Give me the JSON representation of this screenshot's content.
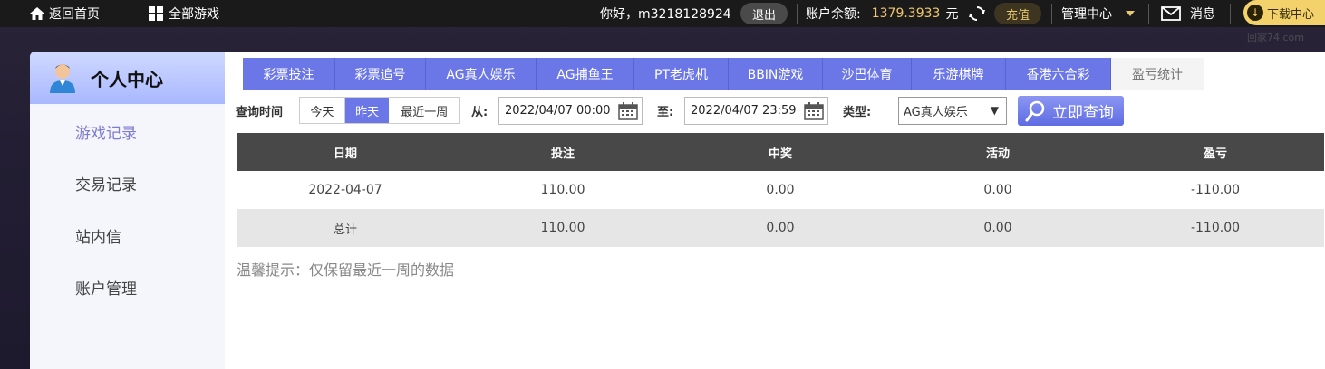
{
  "topbar": {
    "home_label": "返回首页",
    "all_games_label": "全部游戏",
    "greeting": "你好，m3218128924",
    "logout_label": "退出",
    "balance_label": "账户余额:",
    "balance_value": "1379.3933",
    "balance_unit": "元",
    "recharge_label": "充值",
    "admin_label": "管理中心",
    "messages_label": "消息",
    "download_label": "下载中心",
    "watermark": "回家74.com"
  },
  "sidebar": {
    "title": "个人中心",
    "items": [
      {
        "label": "游戏记录"
      },
      {
        "label": "交易记录"
      },
      {
        "label": "站内信"
      },
      {
        "label": "账户管理"
      }
    ]
  },
  "tabs": [
    {
      "label": "彩票投注"
    },
    {
      "label": "彩票追号"
    },
    {
      "label": "AG真人娱乐"
    },
    {
      "label": "AG捕鱼王"
    },
    {
      "label": "PT老虎机"
    },
    {
      "label": "BBIN游戏"
    },
    {
      "label": "沙巴体育"
    },
    {
      "label": "乐游棋牌"
    },
    {
      "label": "香港六合彩"
    },
    {
      "label": "盈亏统计"
    }
  ],
  "filter": {
    "time_label": "查询时间",
    "quick_ranges": [
      {
        "label": "今天"
      },
      {
        "label": "昨天"
      },
      {
        "label": "最近一周"
      }
    ],
    "from_label": "从:",
    "from_value": "2022/04/07 00:00",
    "to_label": "至:",
    "to_value": "2022/04/07 23:59",
    "type_label": "类型:",
    "type_value": "AG真人娱乐",
    "query_button": "立即查询"
  },
  "table": {
    "headers": [
      "日期",
      "投注",
      "中奖",
      "活动",
      "盈亏"
    ],
    "rows": [
      [
        "2022-04-07",
        "110.00",
        "0.00",
        "0.00",
        "-110.00"
      ]
    ],
    "total": [
      "总计",
      "110.00",
      "0.00",
      "0.00",
      "-110.00"
    ]
  },
  "tip": "温馨提示：仅保留最近一周的数据",
  "colors": {
    "accent": "#6b77e7",
    "balance": "#f2c66a",
    "header_bg": "#484848"
  }
}
